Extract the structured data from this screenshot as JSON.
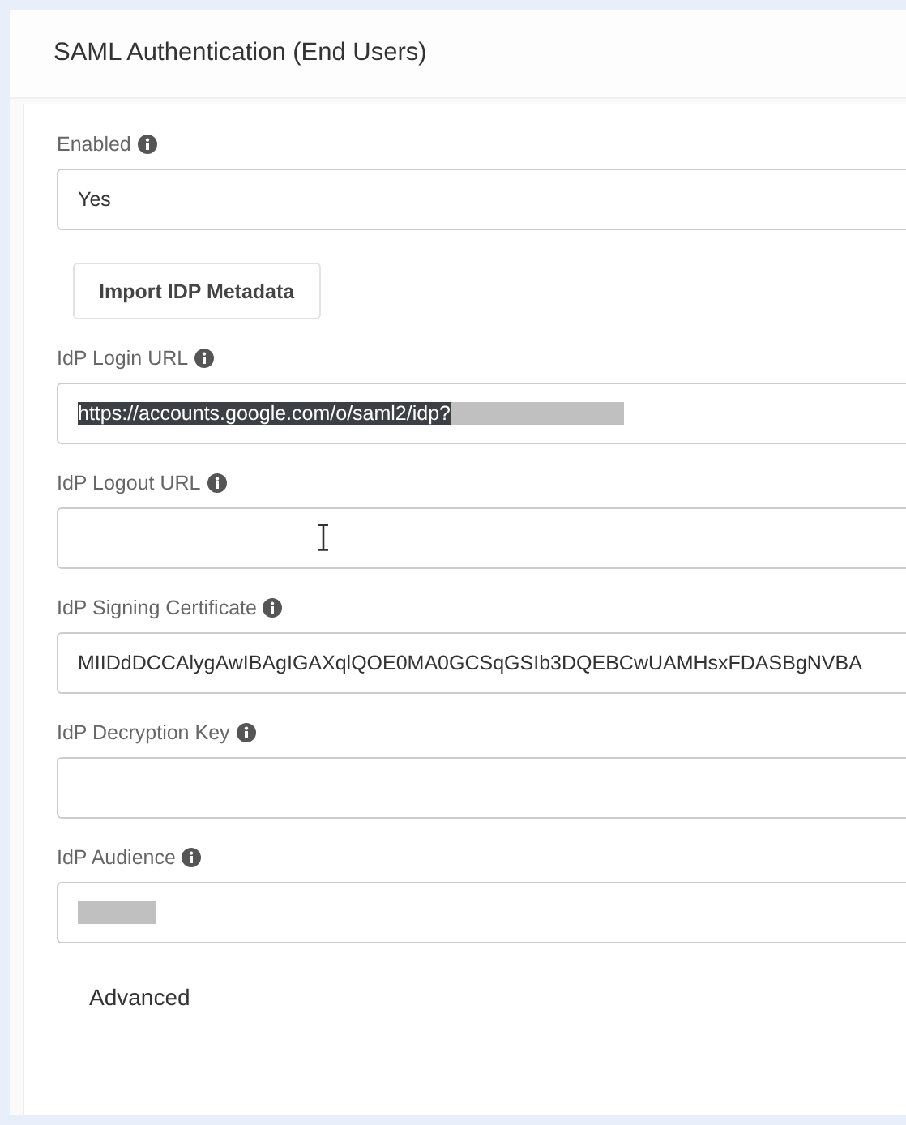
{
  "header": {
    "title": "SAML Authentication (End Users)"
  },
  "items": [
    {
      "kind": "field",
      "label": "Enabled",
      "value": "Yes"
    },
    {
      "kind": "button",
      "label": "Import IDP Metadata"
    },
    {
      "kind": "field",
      "label": "IdP Login URL",
      "value": "https://accounts.google.com/o/saml2/idp?",
      "text_selected": true,
      "redacted": true
    },
    {
      "kind": "field",
      "label": "IdP Logout URL",
      "text_cursor": true
    },
    {
      "kind": "field",
      "label": "IdP Signing Certificate",
      "value": "MIIDdDCCAlygAwIBAgIGAXqlQOE0MA0GCSqGSIb3DQEBCwUAMHsxFDASBgNVBA"
    },
    {
      "kind": "field",
      "label": "IdP Decryption Key"
    },
    {
      "kind": "field",
      "label": "IdP Audience",
      "redacted": true
    }
  ],
  "advanced": {
    "label": "Advanced"
  }
}
